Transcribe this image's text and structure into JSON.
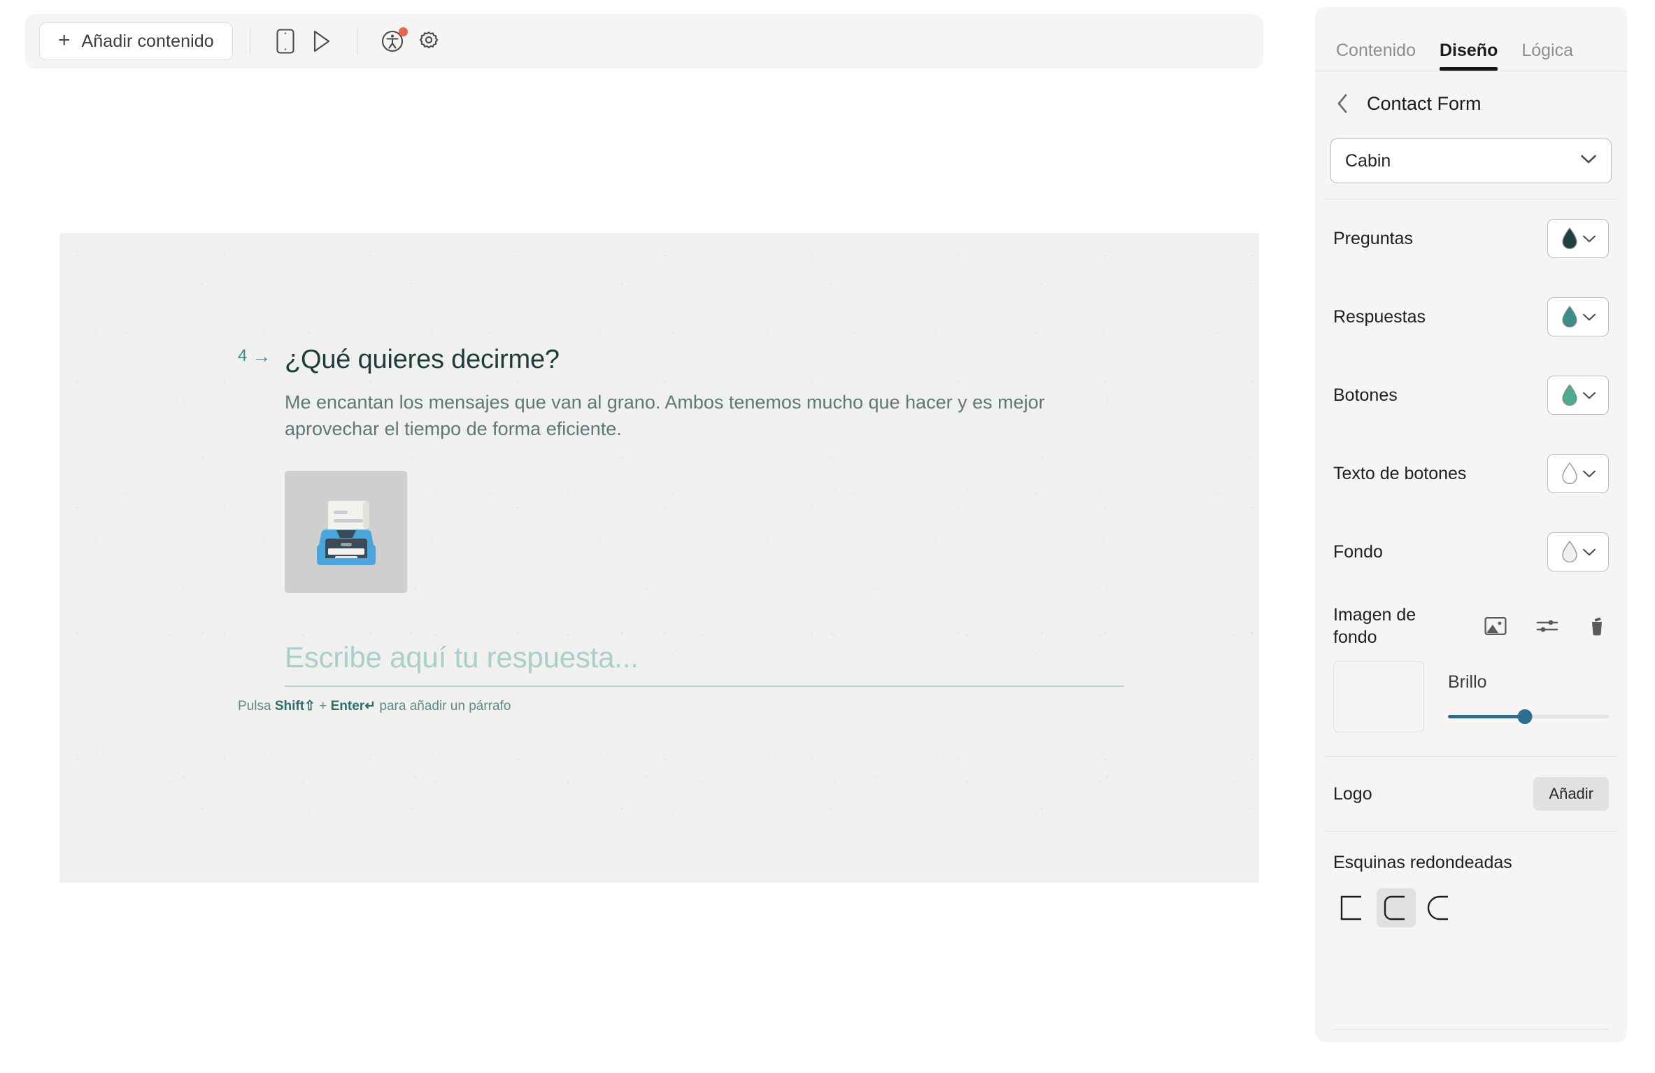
{
  "toolbar": {
    "add_content_label": "Añadir contenido",
    "plus_icon": "plus-icon",
    "icons": [
      {
        "name": "mobile-preview-icon",
        "title": "Vista móvil"
      },
      {
        "name": "play-preview-icon",
        "title": "Previsualizar"
      },
      {
        "name": "accessibility-icon",
        "title": "Accesibilidad",
        "badge": true
      },
      {
        "name": "gear-icon",
        "title": "Configuración"
      }
    ]
  },
  "canvas": {
    "question_number": "4",
    "arrow_glyph": "→",
    "question_title": "¿Qué quieres decirme?",
    "question_description": "Me encantan los mensajes que van al grano. Ambos tenemos mucho que hacer y es mejor aprovechar el tiempo de forma eficiente.",
    "media_icon": "printer-emoji",
    "answer_placeholder": "Escribe aquí tu respuesta...",
    "hint": {
      "prefix": "Pulsa ",
      "key1": "Shift",
      "key1_glyph": "⇧",
      "plus": " + ",
      "key2": "Enter",
      "key2_glyph": "↵",
      "suffix": " para añadir un párrafo"
    },
    "colors": {
      "background": "#f0f0ef",
      "question_text": "#1d3c3c",
      "description_text": "#5d7877",
      "accent": "#3e8f8c",
      "placeholder": "#a8cfcc"
    }
  },
  "panel": {
    "tabs": [
      {
        "label": "Contenido",
        "active": false
      },
      {
        "label": "Diseño",
        "active": true
      },
      {
        "label": "Lógica",
        "active": false
      }
    ],
    "breadcrumb": {
      "back_icon": "chevron-left-icon",
      "title": "Contact Form"
    },
    "font": {
      "value": "Cabin",
      "chevron_icon": "chevron-down-icon"
    },
    "color_rows": [
      {
        "label": "Preguntas",
        "color": "#1d4040",
        "icon": "droplet-icon"
      },
      {
        "label": "Respuestas",
        "color": "#3d8c8c",
        "icon": "droplet-icon"
      },
      {
        "label": "Botones",
        "color": "#4aab91",
        "icon": "droplet-icon"
      },
      {
        "label": "Texto de botones",
        "color": "#ffffff",
        "icon": "droplet-icon"
      },
      {
        "label": "Fondo",
        "color": "#efefef",
        "icon": "droplet-icon"
      }
    ],
    "background_image": {
      "label": "Imagen de fondo",
      "icons": [
        {
          "name": "image-icon",
          "title": "Elegir imagen"
        },
        {
          "name": "adjust-sliders-icon",
          "title": "Ajustes"
        },
        {
          "name": "trash-icon",
          "title": "Eliminar"
        }
      ],
      "brightness_label": "Brillo",
      "brightness_percent": 48,
      "slider_color": "#2d6e8e"
    },
    "logo": {
      "label": "Logo",
      "button_label": "Añadir"
    },
    "rounded_corners": {
      "label": "Esquinas redondeadas",
      "options": [
        {
          "name": "corner-square",
          "radius": 0,
          "selected": false
        },
        {
          "name": "corner-small-round",
          "radius": 10,
          "selected": true
        },
        {
          "name": "corner-large-round",
          "radius": 26,
          "selected": false
        }
      ]
    }
  }
}
